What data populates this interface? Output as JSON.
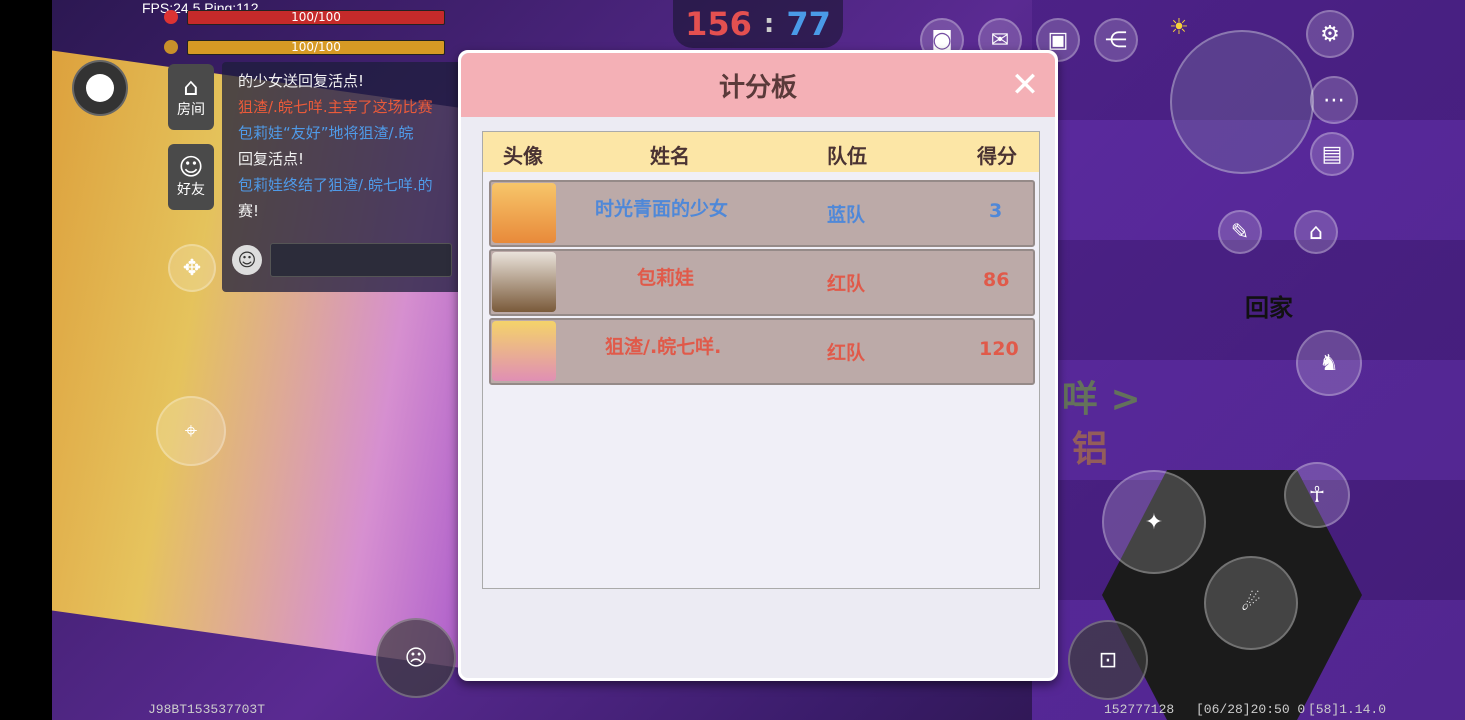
{
  "hud": {
    "fps_ping": "FPS:24.5  Ping:112",
    "health_bar": "100/100",
    "hunger_bar": "100/100",
    "score_red": "156",
    "score_blue": "77",
    "score_sep": ":"
  },
  "sidebar": {
    "room_label": "房间",
    "friends_label": "好友"
  },
  "chat": {
    "lines": [
      "的少女送回复活点!",
      "狙渣/.皖七咩.主宰了这场比赛",
      "包莉娃“友好”地将狙渣/.皖",
      "回复活点!",
      "包莉娃终结了狙渣/.皖七咩.的",
      "赛!"
    ]
  },
  "right_hud": {
    "home_label": "回家"
  },
  "overlay_text": {
    "behind_1": "咩 >",
    "behind_2": "铝"
  },
  "footer": {
    "left_code": "J98BT153537703T",
    "center_code": "152777128",
    "time": "[06/28]20:50 0",
    "version": "[58]1.14.0"
  },
  "scoreboard": {
    "title": "计分板",
    "columns": [
      "头像",
      "姓名",
      "队伍",
      "得分"
    ],
    "rows": [
      {
        "name": "时光青面的少女",
        "team": "蓝队",
        "score": "3",
        "team_color": "#4f88d8"
      },
      {
        "name": "包莉娃",
        "team": "红队",
        "score": "86",
        "team_color": "#e05a4a"
      },
      {
        "name": "狙渣/.皖七咩.",
        "team": "红队",
        "score": "120",
        "team_color": "#e05a4a"
      }
    ]
  }
}
